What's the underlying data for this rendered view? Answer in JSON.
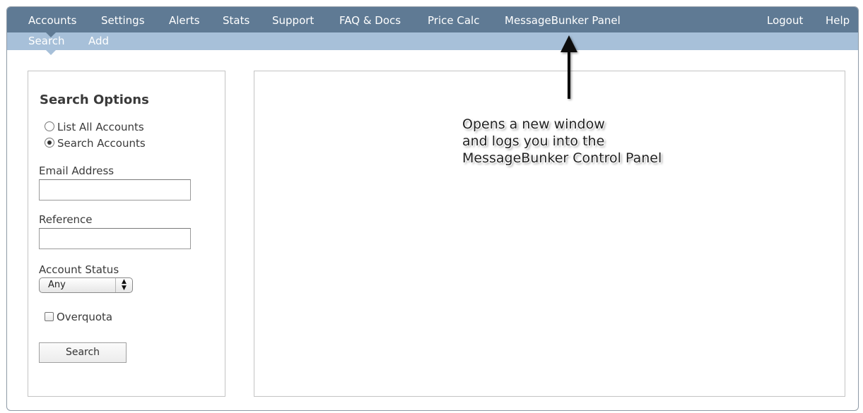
{
  "nav": {
    "items": [
      "Accounts",
      "Settings",
      "Alerts",
      "Stats",
      "Support",
      "FAQ & Docs",
      "Price Calc",
      "MessageBunker Panel"
    ],
    "right_items": [
      "Logout",
      "Help"
    ],
    "active": "Accounts"
  },
  "subnav": {
    "items": [
      "Search",
      "Add"
    ],
    "active": "Search"
  },
  "sidebar": {
    "title": "Search Options",
    "radio_list_all": "List All Accounts",
    "radio_search": "Search Accounts",
    "radio_selected": "Search Accounts",
    "email_label": "Email Address",
    "email_value": "",
    "reference_label": "Reference",
    "reference_value": "",
    "status_label": "Account Status",
    "status_value": "Any",
    "overquota_label": "Overquota",
    "overquota_checked": false,
    "search_button": "Search"
  },
  "annotation": {
    "lines": [
      "Opens a new window",
      "and logs you into the",
      "MessageBunker Control Panel"
    ]
  },
  "colors": {
    "nav_bg": "#5f7a94",
    "subnav_bg": "#a7c0d9"
  }
}
